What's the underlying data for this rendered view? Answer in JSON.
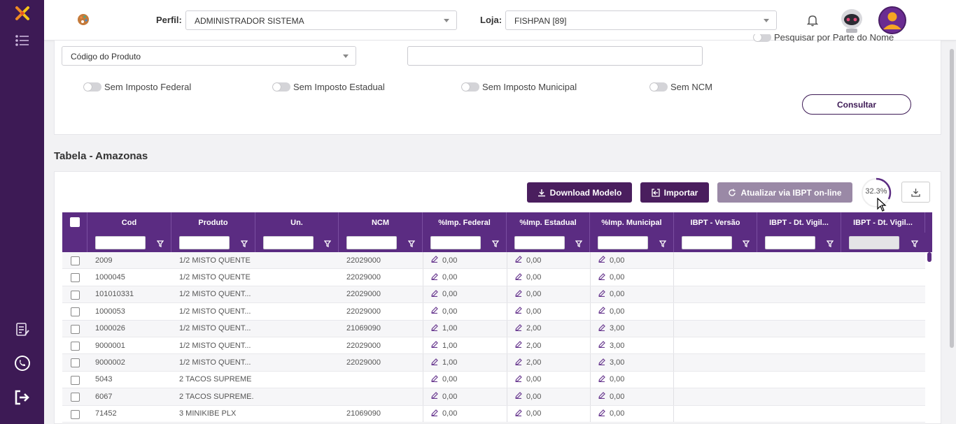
{
  "topbar": {
    "perfil_label": "Perfil",
    "perfil_value": "ADMINISTRADOR SISTEMA",
    "loja_label": "Loja",
    "loja_value": "FISHPAN [89]"
  },
  "filter": {
    "search_field_select": "Código do Produto",
    "search_partial_label": "Pesquisar por Parte do Nome",
    "toggles": [
      "Sem Imposto Federal",
      "Sem Imposto Estadual",
      "Sem Imposto Municipal",
      "Sem NCM"
    ],
    "consultar_label": "Consultar"
  },
  "section_title": "Tabela - Amazonas",
  "actions": {
    "download_label": "Download Modelo",
    "importar_label": "Importar",
    "atualizar_label": "Atualizar via IBPT on-line",
    "progress_text": "32.3%",
    "progress_fraction": 0.323
  },
  "table": {
    "columns": [
      "Cod",
      "Produto",
      "Un.",
      "NCM",
      "%Imp. Federal",
      "%Imp. Estadual",
      "%Imp. Municipal",
      "IBPT - Versão",
      "IBPT - Dt. Vigil...",
      "IBPT - Dt. Vigil..."
    ],
    "rows": [
      {
        "cod": "2009",
        "produto": "1/2 MISTO QUENTE",
        "un": "",
        "ncm": "22029000",
        "federal": "0,00",
        "estadual": "0,00",
        "municipal": "0,00"
      },
      {
        "cod": "1000045",
        "produto": "1/2 MISTO QUENTE",
        "un": "",
        "ncm": "22029000",
        "federal": "0,00",
        "estadual": "0,00",
        "municipal": "0,00"
      },
      {
        "cod": "101010331",
        "produto": "1/2 MISTO QUENT...",
        "un": "",
        "ncm": "22029000",
        "federal": "0,00",
        "estadual": "0,00",
        "municipal": "0,00"
      },
      {
        "cod": "1000053",
        "produto": "1/2 MISTO QUENT...",
        "un": "",
        "ncm": "22029000",
        "federal": "0,00",
        "estadual": "0,00",
        "municipal": "0,00"
      },
      {
        "cod": "1000026",
        "produto": "1/2 MISTO QUENT...",
        "un": "",
        "ncm": "21069090",
        "federal": "1,00",
        "estadual": "2,00",
        "municipal": "3,00"
      },
      {
        "cod": "9000001",
        "produto": "1/2 MISTO QUENT...",
        "un": "",
        "ncm": "22029000",
        "federal": "1,00",
        "estadual": "2,00",
        "municipal": "3,00"
      },
      {
        "cod": "9000002",
        "produto": "1/2 MISTO QUENT...",
        "un": "",
        "ncm": "22029000",
        "federal": "1,00",
        "estadual": "2,00",
        "municipal": "3,00"
      },
      {
        "cod": "5043",
        "produto": "2 TACOS SUPREME",
        "un": "",
        "ncm": "",
        "federal": "0,00",
        "estadual": "0,00",
        "municipal": "0,00"
      },
      {
        "cod": "6067",
        "produto": "2 TACOS SUPREME...",
        "un": "",
        "ncm": "",
        "federal": "0,00",
        "estadual": "0,00",
        "municipal": "0,00"
      },
      {
        "cod": "71452",
        "produto": "3 MINIKIBE PLX",
        "un": "",
        "ncm": "21069090",
        "federal": "0,00",
        "estadual": "0,00",
        "municipal": "0,00"
      }
    ]
  },
  "colors": {
    "sidebar": "#3d1a55",
    "table_header": "#5b2c82",
    "button_dark": "#4a1e5e",
    "button_disabled": "#9a89a6"
  },
  "icons": [
    "logo-icon",
    "menu-list-icon",
    "notes-icon",
    "whatsapp-icon",
    "logout-icon",
    "palette-icon",
    "bell-icon",
    "robot-avatar-icon",
    "user-avatar-icon",
    "download-icon",
    "import-icon",
    "refresh-icon",
    "export-icon",
    "filter-icon",
    "pencil-icon"
  ]
}
